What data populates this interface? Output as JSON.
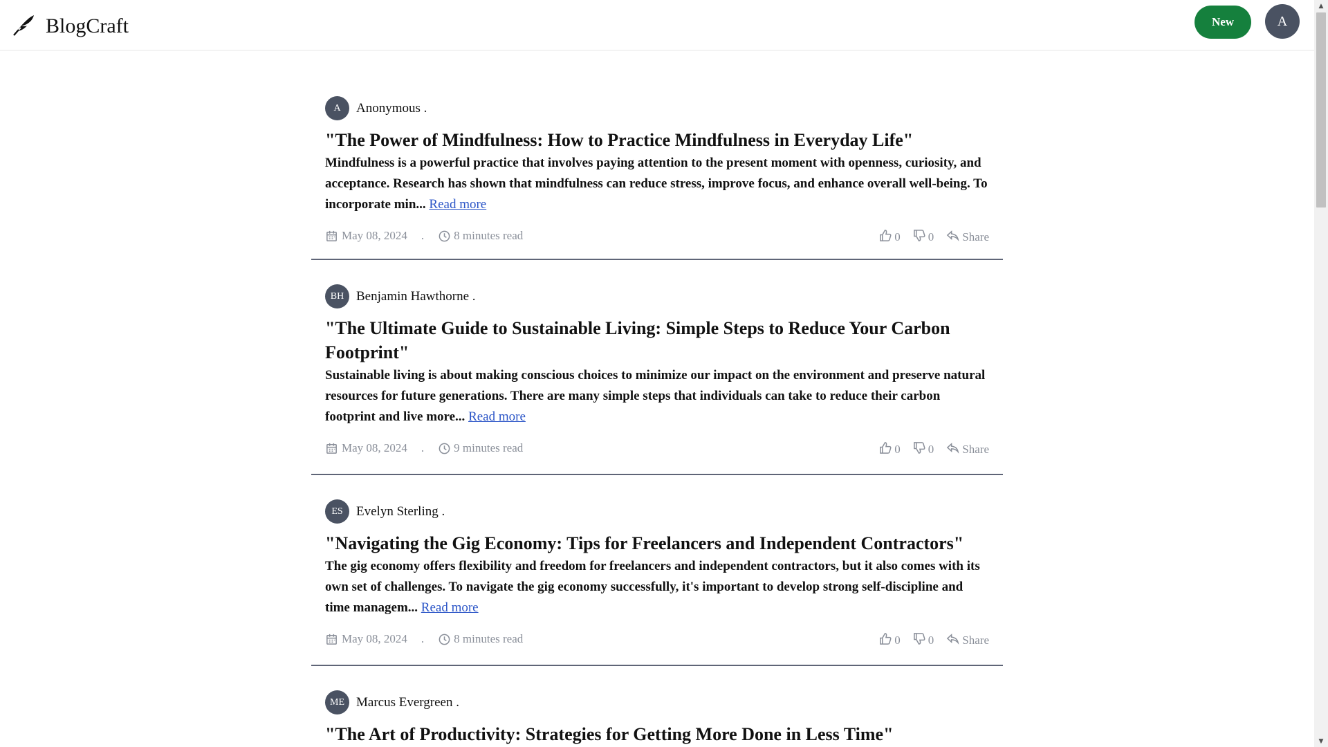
{
  "app": {
    "name": "BlogCraft",
    "new_label": "New",
    "user_initial": "A"
  },
  "posts": [
    {
      "author_initials": "A",
      "author_name": "Anonymous .",
      "title": "\"The Power of Mindfulness: How to Practice Mindfulness in Everyday Life\"",
      "excerpt": "Mindfulness is a powerful practice that involves paying attention to the present moment with openness, curiosity, and acceptance. Research has shown that mindfulness can reduce stress, improve focus, and enhance overall well-being. To incorporate min...",
      "read_more": "Read more",
      "date": "May 08, 2024",
      "separator": ".",
      "read_time": "8 minutes read",
      "likes": "0",
      "dislikes": "0",
      "share": "Share"
    },
    {
      "author_initials": "BH",
      "author_name": "Benjamin Hawthorne .",
      "title": "\"The Ultimate Guide to Sustainable Living: Simple Steps to Reduce Your Carbon Footprint\"",
      "excerpt": "Sustainable living is about making conscious choices to minimize our impact on the environment and preserve natural resources for future generations. There are many simple steps that individuals can take to reduce their carbon footprint and live more...",
      "read_more": "Read more",
      "date": "May 08, 2024",
      "separator": ".",
      "read_time": "9 minutes read",
      "likes": "0",
      "dislikes": "0",
      "share": "Share"
    },
    {
      "author_initials": "ES",
      "author_name": "Evelyn Sterling .",
      "title": "\"Navigating the Gig Economy: Tips for Freelancers and Independent Contractors\"",
      "excerpt": "The gig economy offers flexibility and freedom for freelancers and independent contractors, but it also comes with its own set of challenges. To navigate the gig economy successfully, it's important to develop strong self-discipline and time managem...",
      "read_more": "Read more",
      "date": "May 08, 2024",
      "separator": ".",
      "read_time": "8 minutes read",
      "likes": "0",
      "dislikes": "0",
      "share": "Share"
    },
    {
      "author_initials": "ME",
      "author_name": "Marcus Evergreen .",
      "title": "\"The Art of Productivity: Strategies for Getting More Done in Less Time\""
    }
  ]
}
